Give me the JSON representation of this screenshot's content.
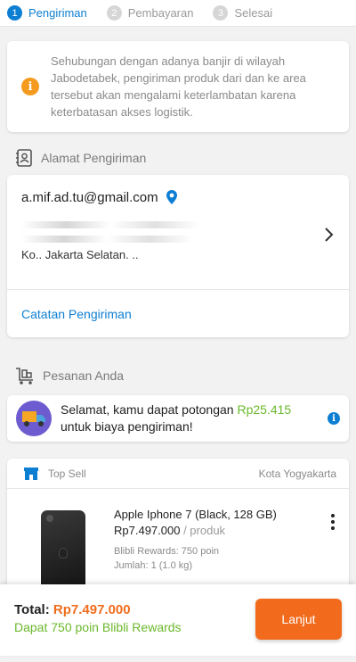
{
  "stepper": {
    "steps": [
      {
        "num": "1",
        "label": "Pengiriman"
      },
      {
        "num": "2",
        "label": "Pembayaran"
      },
      {
        "num": "3",
        "label": "Selesai"
      }
    ]
  },
  "notice": {
    "text": "Sehubungan dengan adanya banjir di wilayah Jabodetabek, pengiriman produk dari dan ke area tersebut akan mengalami keterlambatan karena keterbatasan akses logistik."
  },
  "address_section": {
    "title": "Alamat Pengiriman",
    "email": "a.mif.ad.tu@gmail.com",
    "city_line": "Ko.. Jakarta Selatan. ..",
    "notes_link": "Catatan Pengiriman"
  },
  "order_section": {
    "title": "Pesanan Anda",
    "promo_prefix": "Selamat, kamu dapat potongan ",
    "promo_amount": "Rp25.415",
    "promo_suffix": "untuk biaya pengiriman!"
  },
  "product_card": {
    "shop_name": "Top Sell",
    "shop_location": "Kota Yogyakarta",
    "product_name": "Apple Iphone 7 (Black, 128 GB)",
    "price": "Rp7.497.000",
    "price_unit": "/ produk",
    "rewards": "Blibli Rewards: 750 poin",
    "quantity": "Jumlah: 1 (1.0 kg)"
  },
  "footer": {
    "total_label": "Total:",
    "total_amount": "Rp7.497.000",
    "reward_text": "Dapat 750 poin Blibli Rewards",
    "next_button": "Lanjut"
  },
  "colors": {
    "primary_blue": "#0d7fd3",
    "accent_orange": "#f26b1d",
    "reward_green": "#6bb82c",
    "notice_orange": "#f49b1f"
  },
  "icons": [
    "info-icon",
    "address-book-icon",
    "location-pin-icon",
    "chevron-right-icon",
    "cart-trolley-icon",
    "truck-icon",
    "store-icon",
    "more-vertical-icon"
  ]
}
